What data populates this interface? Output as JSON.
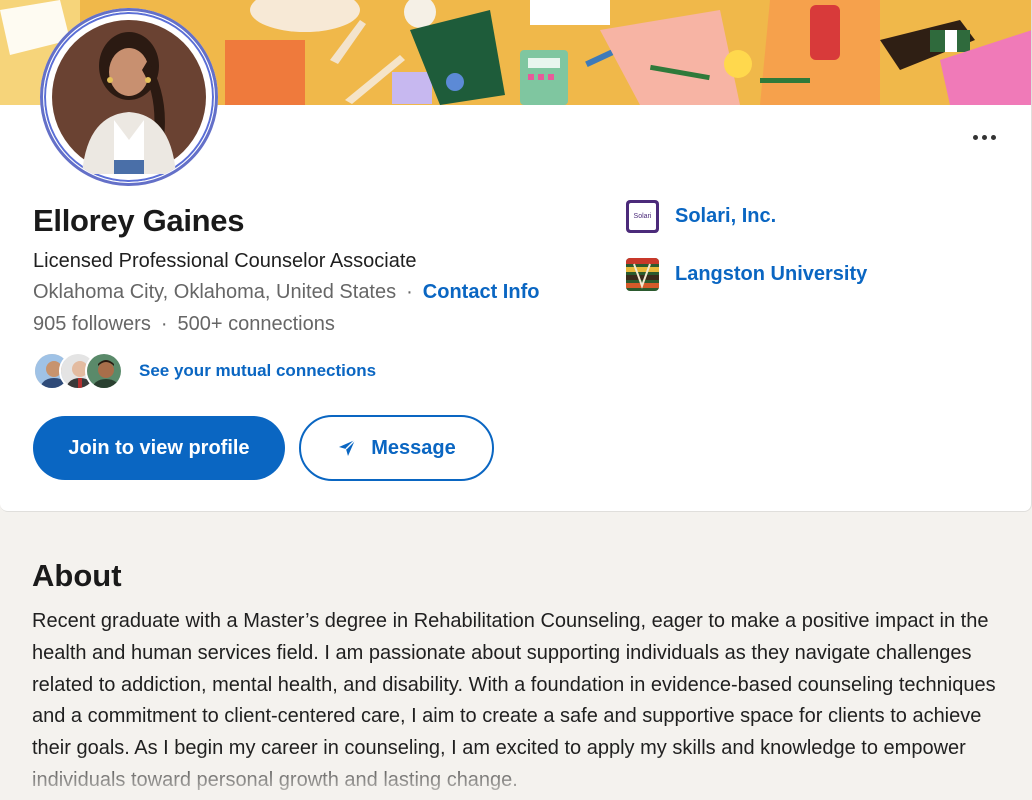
{
  "profile": {
    "name": "Ellorey Gaines",
    "headline": "Licensed Professional Counselor Associate",
    "location": "Oklahoma City, Oklahoma, United States",
    "contact_info_label": "Contact Info",
    "separator": "·",
    "followers": "905 followers",
    "connections": "500+ connections",
    "mutual_label": "See your mutual connections"
  },
  "actions": {
    "join_label": "Join to view profile",
    "message_label": "Message",
    "more_icon": "more-horizontal-icon"
  },
  "organizations": [
    {
      "name": "Solari, Inc.",
      "logo_text": "Solari"
    },
    {
      "name": "Langston University"
    }
  ],
  "about": {
    "title": "About",
    "text": "Recent graduate with a Master’s degree in Rehabilitation Counseling, eager to make a positive impact in the health and human services field. I am passionate about supporting individuals as they navigate challenges related to addiction, mental health, and disability. With a foundation in evidence-based counseling techniques and a commitment to client-centered care, I aim to create a safe and supportive space for clients to achieve their goals. As I begin my career in counseling, I am excited to apply my skills and knowledge to empower individuals toward personal growth and lasting change."
  },
  "colors": {
    "link": "#0a66c2",
    "banner": "#f2b13e",
    "avatar_ring": "#6470c8"
  }
}
